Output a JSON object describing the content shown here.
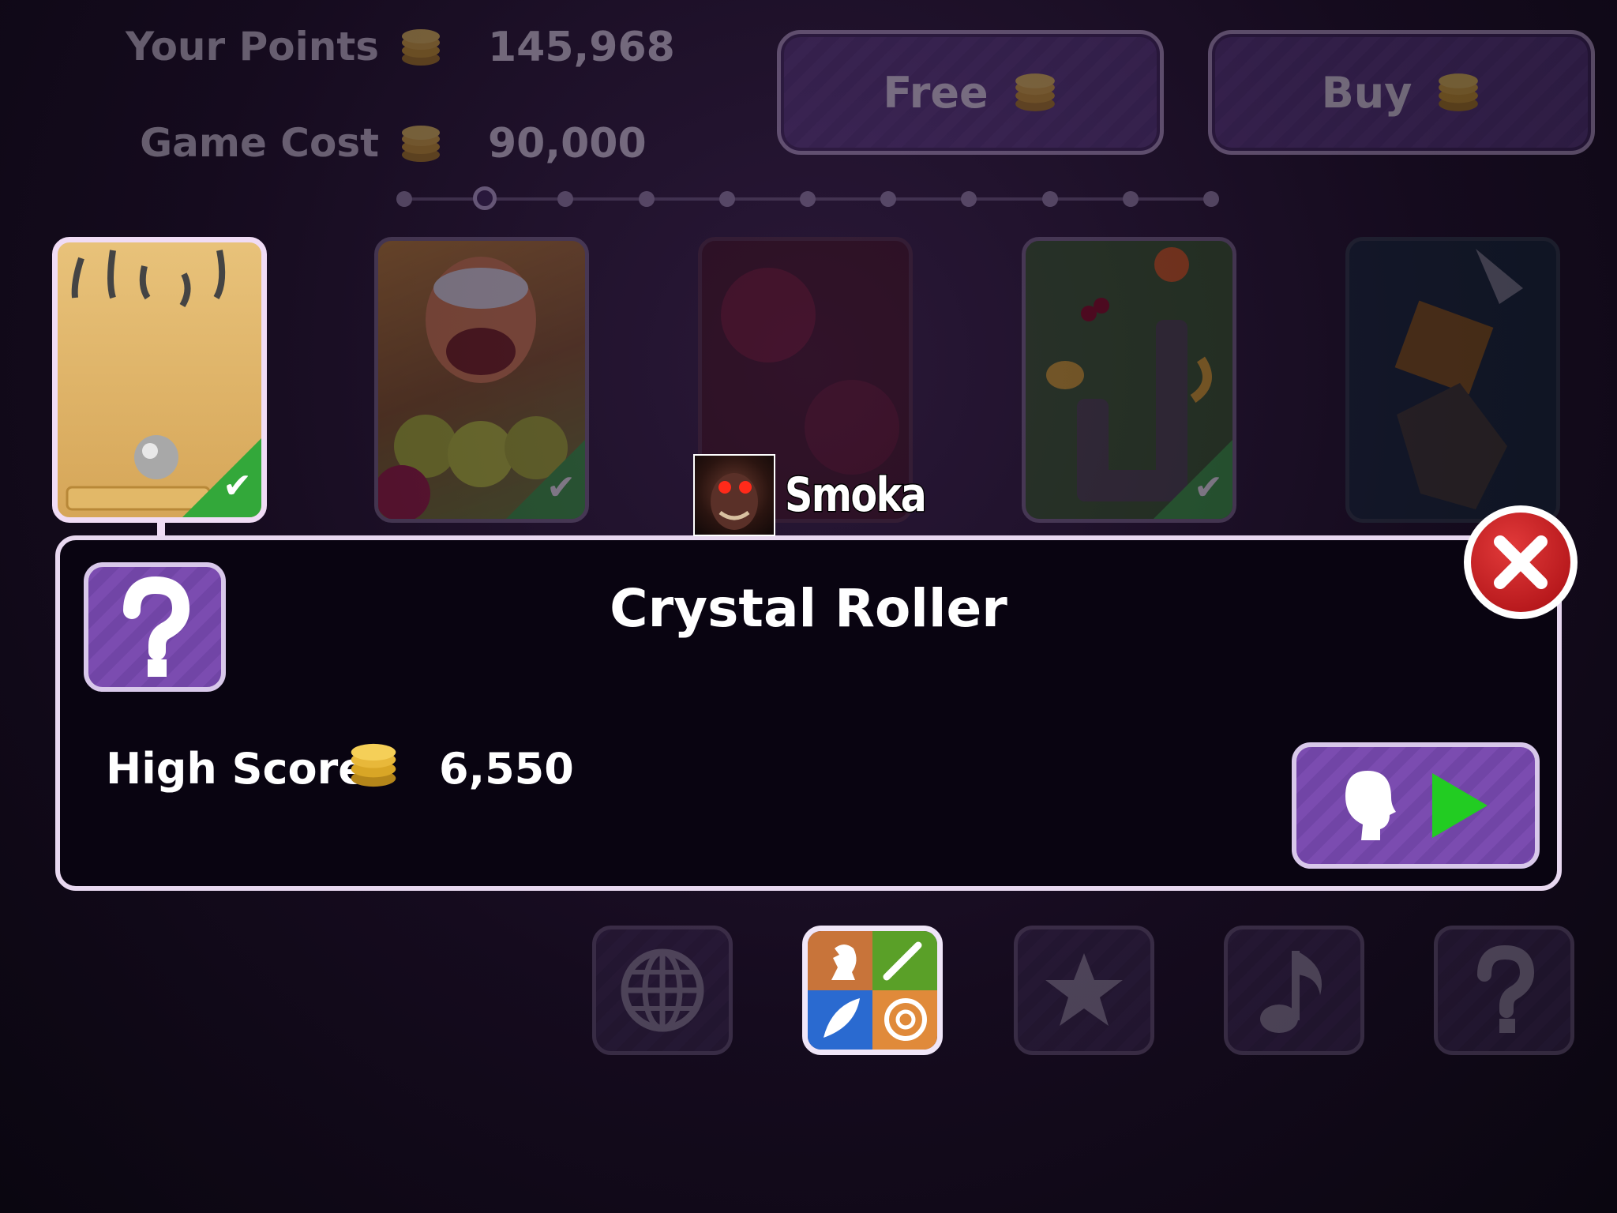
{
  "header": {
    "points_label": "Your Points",
    "points_value": "145,968",
    "cost_label": "Game Cost",
    "cost_value": "90,000",
    "free_button": "Free",
    "buy_button": "Buy"
  },
  "pager": {
    "total": 11,
    "active_index": 1
  },
  "cards": [
    {
      "name": "marble-board-card",
      "selected": true,
      "owned": true
    },
    {
      "name": "farmer-fruit-card",
      "selected": false,
      "owned": true
    },
    {
      "name": "red-balls-card",
      "selected": false,
      "owned": false
    },
    {
      "name": "snake-fruit-card",
      "selected": false,
      "owned": true
    },
    {
      "name": "dark-creature-card",
      "selected": false,
      "owned": false
    }
  ],
  "overlay": {
    "player_name": "Smoka"
  },
  "panel": {
    "title": "Crystal Roller",
    "high_score_label": "High Score",
    "high_score_value": "6,550"
  },
  "nav": [
    "globe-icon",
    "game-categories-icon",
    "star-icon",
    "music-note-icon",
    "help-icon"
  ],
  "colors": {
    "accent_purple": "#7b4cb0",
    "close_red": "#c8181e",
    "play_green": "#22cc22"
  }
}
